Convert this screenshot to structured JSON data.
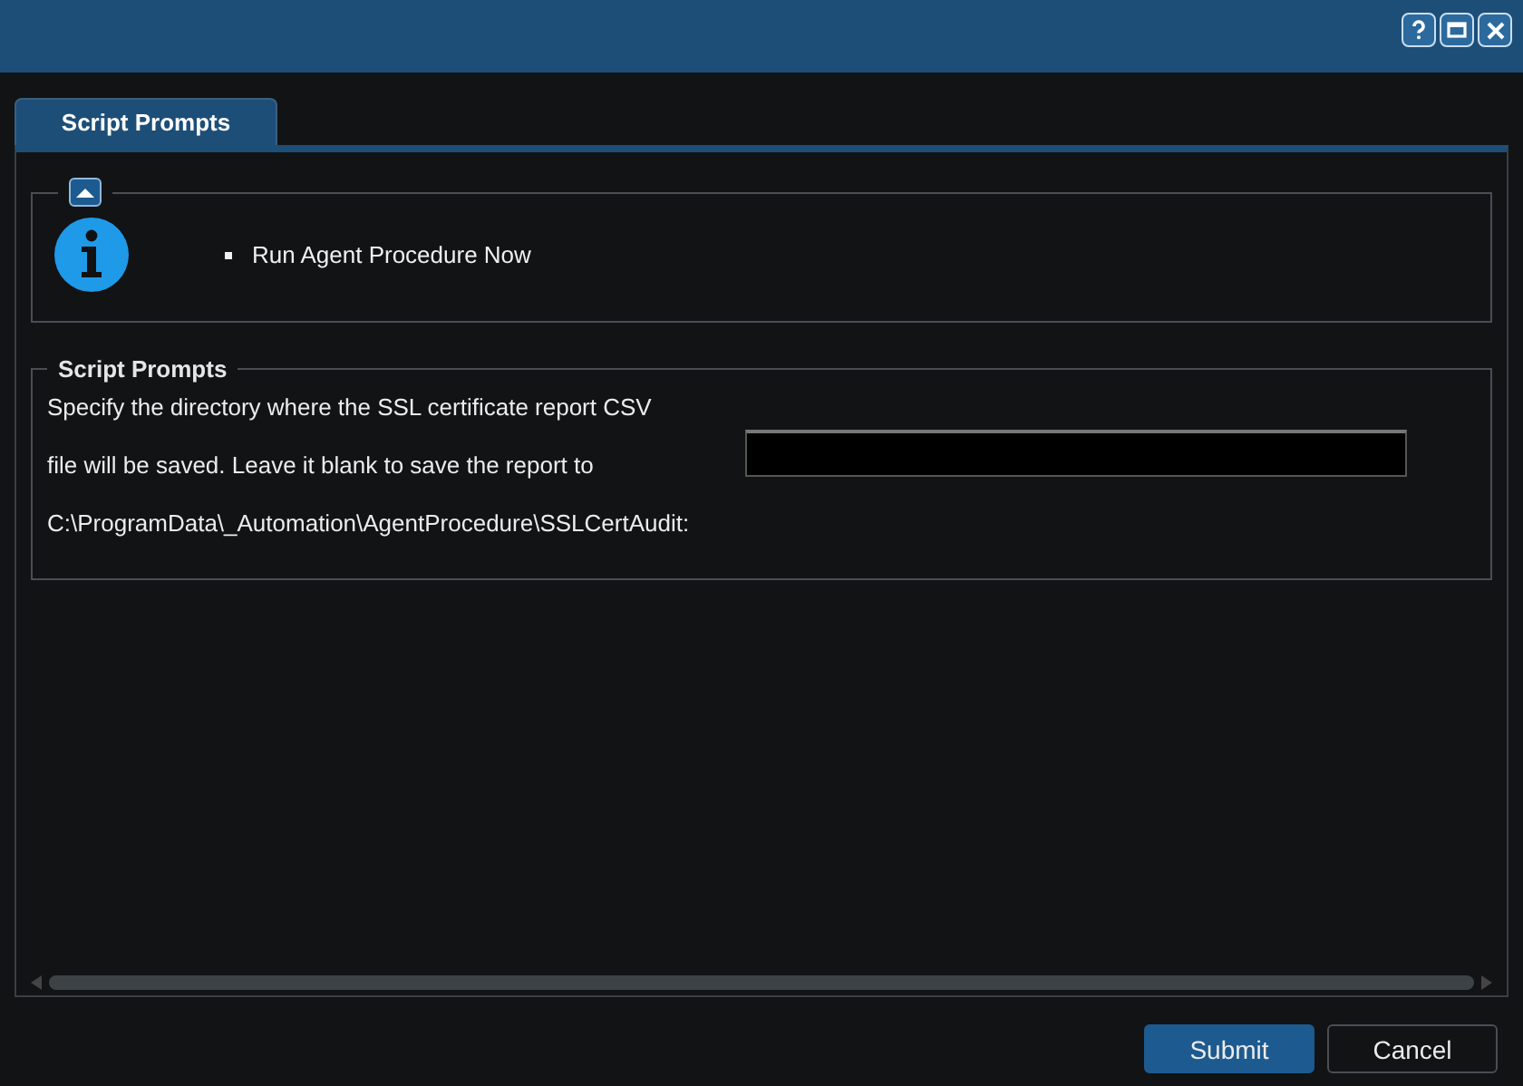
{
  "window": {
    "controls": [
      {
        "kind": "help"
      },
      {
        "kind": "maximize"
      },
      {
        "kind": "close"
      }
    ]
  },
  "tabs": [
    {
      "label": "Script Prompts",
      "selected": true
    }
  ],
  "info": {
    "expanded": true,
    "items": [
      "Run Agent Procedure Now"
    ]
  },
  "prompts": {
    "legend": "Script Prompts",
    "lines": [
      "Specify the directory where the SSL certificate report CSV",
      "file will be saved. Leave it blank to save the report to",
      "C:\\ProgramData\\_Automation\\AgentProcedure\\SSLCertAudit:"
    ]
  },
  "buttons": [
    {
      "label": "Submit",
      "primary": true
    },
    {
      "label": "Cancel",
      "primary": false
    }
  ]
}
